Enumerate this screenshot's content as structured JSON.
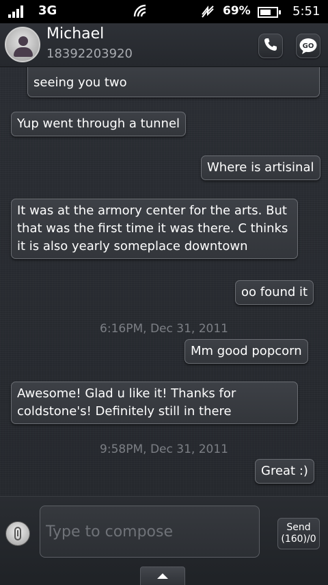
{
  "status_bar": {
    "network": "3G",
    "battery_percent": "69%",
    "battery_level": 0.69,
    "time": "5:51",
    "icons": [
      "signal-icon",
      "wifi-icon",
      "data-sync-icon",
      "battery-icon"
    ]
  },
  "header": {
    "contact_name": "Michael",
    "contact_number": "18392203920",
    "call_icon": "phone-icon",
    "go_label": "GO"
  },
  "messages": [
    {
      "direction": "incoming",
      "text": "seeing you two"
    },
    {
      "direction": "incoming",
      "text": "Yup went through a tunnel"
    },
    {
      "direction": "outgoing",
      "text": "Where is artisinal"
    },
    {
      "direction": "incoming",
      "lines": [
        "It was at the armory center for the arts. But",
        "that was the first time it was there. C thinks",
        "it is also yearly someplace downtown"
      ]
    },
    {
      "direction": "outgoing",
      "text": "oo found it"
    },
    {
      "type": "timestamp",
      "text": "6:16PM, Dec 31, 2011"
    },
    {
      "direction": "outgoing",
      "text": "Mm good popcorn"
    },
    {
      "direction": "incoming",
      "lines": [
        "Awesome! Glad u like it! Thanks for",
        "coldstone's! Definitely still in there"
      ]
    },
    {
      "type": "timestamp",
      "text": "9:58PM, Dec 31, 2011"
    },
    {
      "direction": "outgoing",
      "text": "Great :)"
    }
  ],
  "compose": {
    "placeholder": "Type to compose",
    "send_label": "Send",
    "send_counter": "(160)/0",
    "attach_icon": "paperclip-icon",
    "expand_icon": "chevron-up-icon"
  },
  "colors": {
    "background": "#26292e",
    "bubble_fill": "#383b40",
    "bubble_border": "#6a6d73",
    "timestamp": "#7c7f85"
  }
}
